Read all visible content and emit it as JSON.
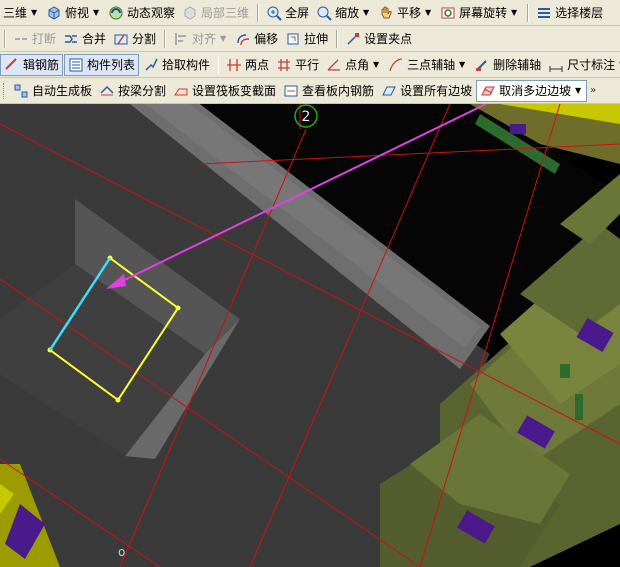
{
  "toolbar1": {
    "items": [
      {
        "label": "三维",
        "icon": "",
        "dropdown": true
      },
      {
        "label": "俯视",
        "icon": "cube-icon",
        "dropdown": true
      },
      {
        "label": "动态观察",
        "icon": "rotate-view-icon"
      },
      {
        "label": "局部三维",
        "icon": "local-3d-icon",
        "disabled": true
      },
      {
        "label": "全屏",
        "icon": "zoom-fullscreen-icon"
      },
      {
        "label": "缩放",
        "icon": "zoom-icon",
        "dropdown": true
      },
      {
        "label": "平移",
        "icon": "pan-hand-icon",
        "dropdown": true
      },
      {
        "label": "屏幕旋转",
        "icon": "screen-rotate-icon",
        "dropdown": true
      },
      {
        "label": "选择楼层",
        "icon": "floor-select-icon"
      }
    ]
  },
  "toolbar2": {
    "items": [
      {
        "label": "打断",
        "icon": "break-icon",
        "disabled": true
      },
      {
        "label": "合并",
        "icon": "merge-icon"
      },
      {
        "label": "分割",
        "icon": "split-icon"
      },
      {
        "label": "对齐",
        "icon": "align-icon",
        "disabled": true,
        "dropdown": true
      },
      {
        "label": "偏移",
        "icon": "offset-icon"
      },
      {
        "label": "拉伸",
        "icon": "stretch-icon"
      },
      {
        "label": "设置夹点",
        "icon": "grip-point-icon"
      }
    ]
  },
  "toolbar3": {
    "items": [
      {
        "label": "辑钢筋",
        "icon": "edit-rebar-icon",
        "state": "pressed"
      },
      {
        "label": "构件列表",
        "icon": "component-list-icon",
        "state": "pressed"
      },
      {
        "label": "拾取构件",
        "icon": "pick-component-icon"
      },
      {
        "label": "两点",
        "icon": "two-point-axis-icon"
      },
      {
        "label": "平行",
        "icon": "parallel-axis-icon"
      },
      {
        "label": "点角",
        "icon": "point-angle-icon",
        "dropdown": true
      },
      {
        "label": "三点辅轴",
        "icon": "three-point-axis-icon",
        "dropdown": true
      },
      {
        "label": "删除辅轴",
        "icon": "delete-axis-icon"
      },
      {
        "label": "尺寸标注",
        "icon": "dimension-icon",
        "dropdown": true
      }
    ]
  },
  "toolbar4": {
    "items": [
      {
        "label": "自动生成板",
        "icon": "auto-slab-icon"
      },
      {
        "label": "按梁分割",
        "icon": "split-by-beam-icon"
      },
      {
        "label": "设置筏板变截面",
        "icon": "raft-section-icon"
      },
      {
        "label": "查看板内钢筋",
        "icon": "view-slab-rebar-icon"
      },
      {
        "label": "设置所有边坡",
        "icon": "set-slopes-icon"
      },
      {
        "label": "取消多边边坡",
        "icon": "cancel-slopes-icon",
        "state": "selected",
        "dropdown": true
      }
    ]
  },
  "viewport": {
    "axis_label": "2",
    "colors": {
      "slab": "#3c3c3c",
      "beam": "#707070",
      "selection": "#ffff33",
      "selected_edge": "#33e0ff",
      "arrow": "#e040e0",
      "grid_line": "#d01010",
      "footing": "#6f7a3a",
      "marker": "#4a1a8c"
    }
  }
}
